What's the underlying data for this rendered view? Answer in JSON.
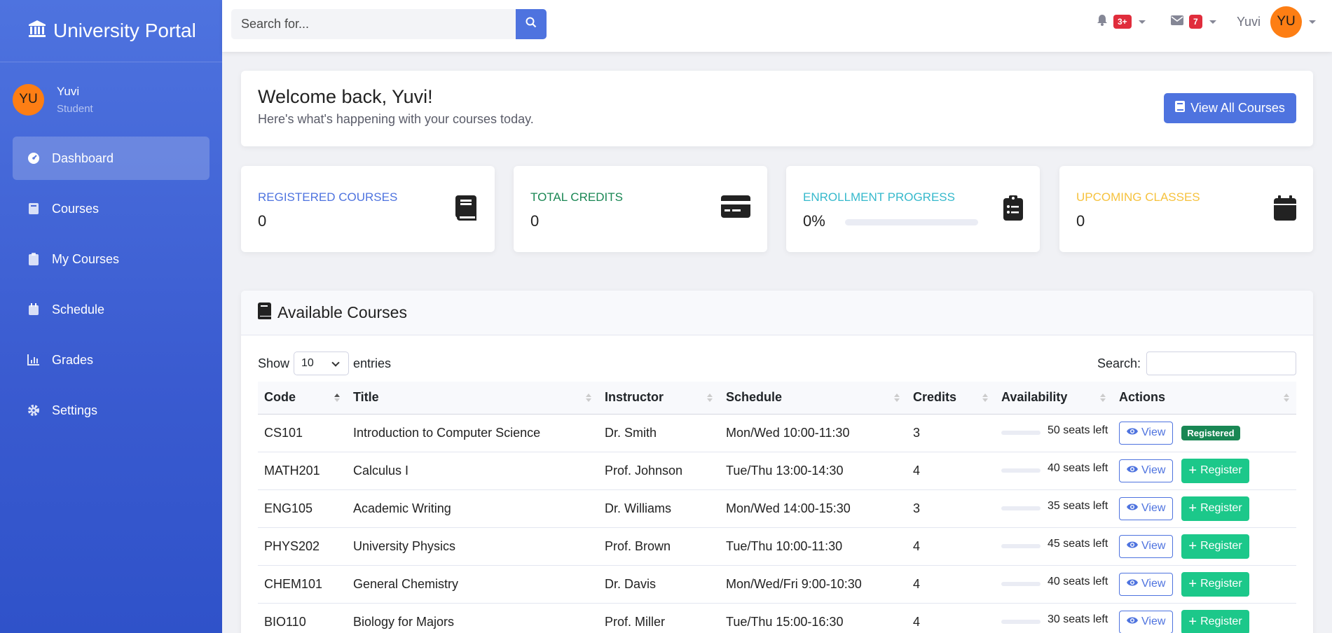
{
  "brand": {
    "title": "University Portal"
  },
  "user": {
    "initials": "YU",
    "name": "Yuvi",
    "role": "Student"
  },
  "nav": [
    {
      "label": "Dashboard",
      "icon": "gauge-icon",
      "active": true
    },
    {
      "label": "Courses",
      "icon": "book-icon"
    },
    {
      "label": "My Courses",
      "icon": "clipboard-icon"
    },
    {
      "label": "Schedule",
      "icon": "calendar-icon"
    },
    {
      "label": "Grades",
      "icon": "chart-icon"
    },
    {
      "label": "Settings",
      "icon": "gear-icon"
    }
  ],
  "topbar": {
    "search_placeholder": "Search for...",
    "alerts_count": "3+",
    "messages_count": "7",
    "user_name": "Yuvi",
    "user_initials": "YU"
  },
  "welcome": {
    "title": "Welcome back, Yuvi!",
    "subtitle": "Here's what's happening with your courses today.",
    "button": "View All Courses"
  },
  "stats": {
    "registered": {
      "label": "Registered Courses",
      "value": "0",
      "color": "#4e73df"
    },
    "credits": {
      "label": "Total Credits",
      "value": "0",
      "color": "#1a8754"
    },
    "progress": {
      "label": "Enrollment Progress",
      "value": "0%",
      "fraction": 0,
      "color": "#36b9cc"
    },
    "upcoming": {
      "label": "Upcoming Classes",
      "value": "0",
      "color": "#f6c23e"
    }
  },
  "courses": {
    "title": "Available Courses",
    "show_label": "Show",
    "entries_value": "10",
    "entries_label": "entries",
    "search_label": "Search:",
    "columns": [
      "Code",
      "Title",
      "Instructor",
      "Schedule",
      "Credits",
      "Availability",
      "Actions"
    ],
    "rows": [
      {
        "code": "CS101",
        "title": "Introduction to Computer Science",
        "instructor": "Dr. Smith",
        "schedule": "Mon/Wed 10:00-11:30",
        "credits": "3",
        "availability": "50 seats left",
        "view": "View",
        "status": "Registered"
      },
      {
        "code": "MATH201",
        "title": "Calculus I",
        "instructor": "Prof. Johnson",
        "schedule": "Tue/Thu 13:00-14:30",
        "credits": "4",
        "availability": "40 seats left",
        "view": "View",
        "action": "Register"
      },
      {
        "code": "ENG105",
        "title": "Academic Writing",
        "instructor": "Dr. Williams",
        "schedule": "Mon/Wed 14:00-15:30",
        "credits": "3",
        "availability": "35 seats left",
        "view": "View",
        "action": "Register"
      },
      {
        "code": "PHYS202",
        "title": "University Physics",
        "instructor": "Prof. Brown",
        "schedule": "Tue/Thu 10:00-11:30",
        "credits": "4",
        "availability": "45 seats left",
        "view": "View",
        "action": "Register"
      },
      {
        "code": "CHEM101",
        "title": "General Chemistry",
        "instructor": "Dr. Davis",
        "schedule": "Mon/Wed/Fri 9:00-10:30",
        "credits": "4",
        "availability": "40 seats left",
        "view": "View",
        "action": "Register"
      },
      {
        "code": "BIO110",
        "title": "Biology for Majors",
        "instructor": "Prof. Miller",
        "schedule": "Tue/Thu 15:00-16:30",
        "credits": "4",
        "availability": "30 seats left",
        "view": "View",
        "action": "Register"
      }
    ]
  }
}
